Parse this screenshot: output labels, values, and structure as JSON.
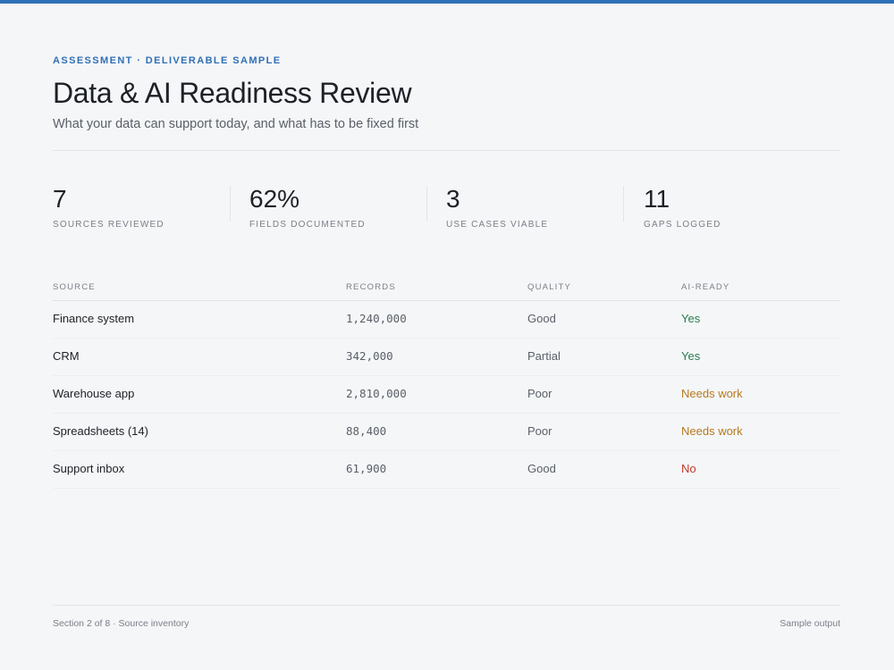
{
  "header": {
    "eyebrow": "ASSESSMENT · DELIVERABLE SAMPLE",
    "title": "Data & AI Readiness Review",
    "subtitle": "What your data can support today, and what has to be fixed first"
  },
  "stats": [
    {
      "value": "7",
      "label": "SOURCES REVIEWED"
    },
    {
      "value": "62%",
      "label": "FIELDS DOCUMENTED"
    },
    {
      "value": "3",
      "label": "USE CASES VIABLE"
    },
    {
      "value": "11",
      "label": "GAPS LOGGED"
    }
  ],
  "table": {
    "columns": {
      "source": "SOURCE",
      "records": "RECORDS",
      "quality": "QUALITY",
      "ai_ready": "AI-READY"
    },
    "rows": [
      {
        "source": "Finance system",
        "records": "1,240,000",
        "quality": "Good",
        "ai_ready": "Yes",
        "status": "yes"
      },
      {
        "source": "CRM",
        "records": "342,000",
        "quality": "Partial",
        "ai_ready": "Yes",
        "status": "yes"
      },
      {
        "source": "Warehouse app",
        "records": "2,810,000",
        "quality": "Poor",
        "ai_ready": "Needs work",
        "status": "needs-work"
      },
      {
        "source": "Spreadsheets (14)",
        "records": "88,400",
        "quality": "Poor",
        "ai_ready": "Needs work",
        "status": "needs-work"
      },
      {
        "source": "Support inbox",
        "records": "61,900",
        "quality": "Good",
        "ai_ready": "No",
        "status": "no"
      }
    ]
  },
  "status_colors": {
    "yes": "#2a7d4f",
    "needs-work": "#b7791f",
    "no": "#c0392b"
  },
  "accent_color": "#2f6fb5",
  "footer": {
    "left": "Section 2 of 8 · Source inventory",
    "right": "Sample output"
  }
}
